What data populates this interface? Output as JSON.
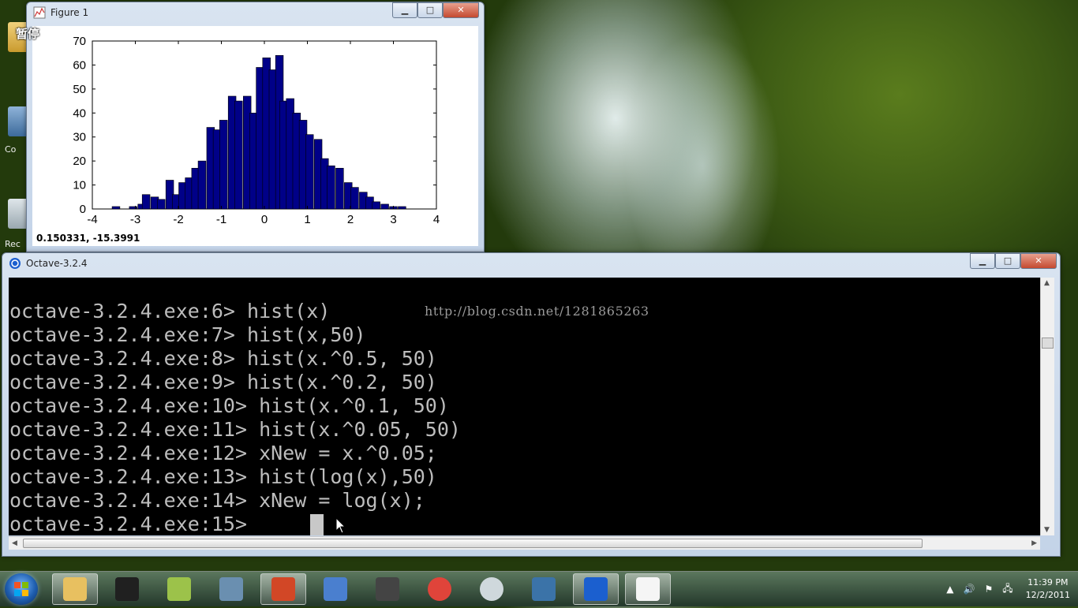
{
  "desktop": {
    "icon_labels": [
      "Co",
      "Rec"
    ]
  },
  "overlay_badge": "暂停",
  "figure_window": {
    "title": "Figure 1",
    "controls": {
      "minimize": "▁",
      "maximize": "□",
      "close": "✕"
    },
    "coordinate_readout": "0.150331, -15.3991"
  },
  "chart_data": {
    "type": "bar",
    "title": "",
    "xlabel": "",
    "ylabel": "",
    "xlim": [
      -4,
      4
    ],
    "ylim": [
      0,
      70
    ],
    "xticks": [
      -4,
      -3,
      -2,
      -1,
      0,
      1,
      2,
      3,
      4
    ],
    "yticks": [
      0,
      10,
      20,
      30,
      40,
      50,
      60,
      70
    ],
    "bar_color": "#000088",
    "bins": [
      {
        "x": -3.45,
        "y": 1
      },
      {
        "x": -3.25,
        "y": 0
      },
      {
        "x": -3.05,
        "y": 1
      },
      {
        "x": -2.85,
        "y": 2
      },
      {
        "x": -2.75,
        "y": 6
      },
      {
        "x": -2.55,
        "y": 5
      },
      {
        "x": -2.4,
        "y": 4
      },
      {
        "x": -2.2,
        "y": 12
      },
      {
        "x": -2.05,
        "y": 6
      },
      {
        "x": -1.9,
        "y": 11
      },
      {
        "x": -1.75,
        "y": 13
      },
      {
        "x": -1.6,
        "y": 17
      },
      {
        "x": -1.45,
        "y": 20
      },
      {
        "x": -1.25,
        "y": 34
      },
      {
        "x": -1.1,
        "y": 33
      },
      {
        "x": -0.95,
        "y": 37
      },
      {
        "x": -0.75,
        "y": 47
      },
      {
        "x": -0.6,
        "y": 45
      },
      {
        "x": -0.4,
        "y": 47
      },
      {
        "x": -0.25,
        "y": 40
      },
      {
        "x": -0.1,
        "y": 59
      },
      {
        "x": 0.05,
        "y": 63
      },
      {
        "x": 0.2,
        "y": 58
      },
      {
        "x": 0.35,
        "y": 64
      },
      {
        "x": 0.45,
        "y": 45
      },
      {
        "x": 0.6,
        "y": 46
      },
      {
        "x": 0.75,
        "y": 40
      },
      {
        "x": 0.9,
        "y": 37
      },
      {
        "x": 1.05,
        "y": 31
      },
      {
        "x": 1.25,
        "y": 29
      },
      {
        "x": 1.4,
        "y": 21
      },
      {
        "x": 1.55,
        "y": 18
      },
      {
        "x": 1.75,
        "y": 17
      },
      {
        "x": 1.95,
        "y": 11
      },
      {
        "x": 2.1,
        "y": 9
      },
      {
        "x": 2.3,
        "y": 7
      },
      {
        "x": 2.45,
        "y": 5
      },
      {
        "x": 2.6,
        "y": 3
      },
      {
        "x": 2.8,
        "y": 2
      },
      {
        "x": 3.0,
        "y": 1
      },
      {
        "x": 3.2,
        "y": 1
      }
    ],
    "bin_width": 0.18
  },
  "console_window": {
    "title": "Octave-3.2.4",
    "controls": {
      "minimize": "▁",
      "maximize": "□",
      "close": "✕"
    },
    "watermark": "http://blog.csdn.net/1281865263",
    "lines": [
      "octave-3.2.4.exe:6> hist(x)",
      "octave-3.2.4.exe:7> hist(x,50)",
      "octave-3.2.4.exe:8> hist(x.^0.5, 50)",
      "octave-3.2.4.exe:9> hist(x.^0.2, 50)",
      "octave-3.2.4.exe:10> hist(x.^0.1, 50)",
      "octave-3.2.4.exe:11> hist(x.^0.05, 50)",
      "octave-3.2.4.exe:12> xNew = x.^0.05;",
      "octave-3.2.4.exe:13> hist(log(x),50)",
      "octave-3.2.4.exe:14> xNew = log(x);",
      "octave-3.2.4.exe:15> "
    ]
  },
  "taskbar": {
    "buttons": [
      {
        "name": "windows-explorer",
        "icon": "folder-icon",
        "color": "#e8c060",
        "active": true
      },
      {
        "name": "video-camera-app",
        "icon": "camcorder-icon",
        "color": "#202020",
        "active": false
      },
      {
        "name": "notes-app",
        "icon": "sticky-note-icon",
        "color": "#9cc24a",
        "active": false
      },
      {
        "name": "network-app",
        "icon": "network-icon",
        "color": "#6a8fb0",
        "active": false
      },
      {
        "name": "powerpoint",
        "icon": "powerpoint-icon",
        "color": "#d24726",
        "active": true
      },
      {
        "name": "remote-desktop",
        "icon": "remote-desktop-icon",
        "color": "#4a7fcf",
        "active": false
      },
      {
        "name": "camera-app",
        "icon": "camera-icon",
        "color": "#444444",
        "active": false
      },
      {
        "name": "chrome",
        "icon": "chrome-icon",
        "color": "#e0443a",
        "active": false
      },
      {
        "name": "webcam-app",
        "icon": "webcam-icon",
        "color": "#cfd8dc",
        "active": false
      },
      {
        "name": "python",
        "icon": "python-icon",
        "color": "#3b73a8",
        "active": false
      },
      {
        "name": "octave-console",
        "icon": "octave-icon",
        "color": "#1b5fcf",
        "active": true
      },
      {
        "name": "figure-window",
        "icon": "plot-icon",
        "color": "#f5f5f5",
        "active": true
      }
    ],
    "tray": {
      "show_hidden": "▲",
      "volume": "🔊",
      "flag": "⚑",
      "network": "🖧"
    },
    "clock": {
      "time": "11:39 PM",
      "date": "12/2/2011"
    }
  }
}
